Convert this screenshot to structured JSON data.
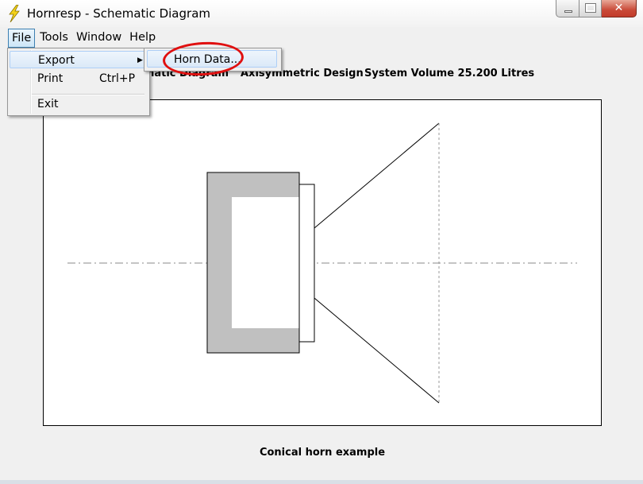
{
  "window": {
    "title": "Hornresp - Schematic Diagram",
    "icon": "lightning-bolt-icon"
  },
  "menubar": {
    "items": [
      "File",
      "Tools",
      "Window",
      "Help"
    ],
    "active": "File"
  },
  "file_menu": {
    "items": [
      {
        "label": "Export",
        "submenu": true
      },
      {
        "label": "Print",
        "shortcut": "Ctrl+P"
      },
      {
        "label": "Exit"
      }
    ]
  },
  "export_submenu": {
    "items": [
      {
        "label": "Horn Data..."
      }
    ]
  },
  "diagram": {
    "heading_left": "ematic Diagram",
    "heading_design": "Axisymmetric Design",
    "heading_volume": "System Volume 25.200 Litres",
    "caption": "Conical horn example"
  },
  "colors": {
    "highlight": "#e01010",
    "chamber_fill": "#c0c0c0",
    "driver_line": "#cc0000"
  }
}
